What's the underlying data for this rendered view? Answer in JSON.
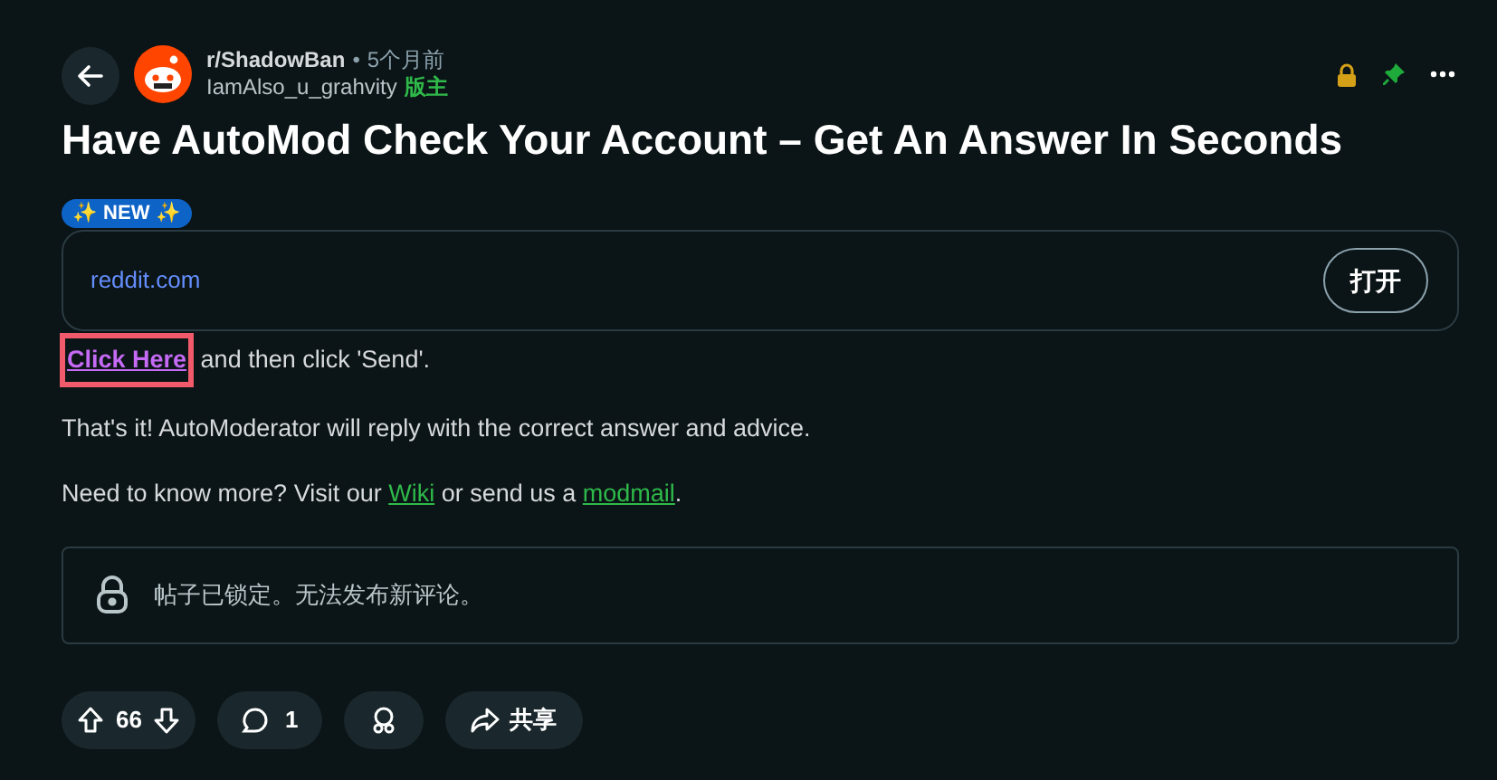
{
  "post": {
    "subreddit": "r/ShadowBan",
    "separator": "•",
    "time": "5个月前",
    "author": "IamAlso_u_grahvity",
    "author_flair": "版主",
    "locked": true,
    "pinned": true,
    "title": "Have AutoMod Check Your Account – Get An Answer In Seconds",
    "badge": "✨ NEW ✨"
  },
  "link_card": {
    "domain": "reddit.com",
    "button": "打开"
  },
  "body": [
    {
      "kind": "highlighted_link",
      "link": "Click Here",
      "rest": " and then click 'Send'."
    },
    {
      "kind": "text",
      "text": "That's it! AutoModerator will reply with the correct answer and advice."
    },
    {
      "kind": "links",
      "parts": [
        {
          "text": "Need to know more? Visit our ",
          "kind": "text"
        },
        {
          "text": "Wiki",
          "kind": "link"
        },
        {
          "text": " or send us a ",
          "kind": "text"
        },
        {
          "text": "modmail",
          "kind": "link"
        },
        {
          "text": ".",
          "kind": "text"
        }
      ]
    }
  ],
  "locked_notice": "帖子已锁定。无法发布新评论。",
  "actions": {
    "score": "66",
    "comments": "1",
    "share": "共享"
  }
}
